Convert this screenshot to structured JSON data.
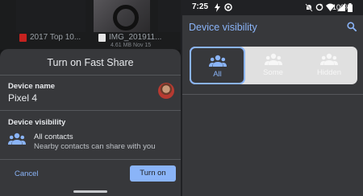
{
  "left": {
    "files": [
      {
        "name": "2017 Top 10...",
        "meta": ""
      },
      {
        "name": "IMG_201911...",
        "meta": "4.61 MB Nov 15"
      }
    ],
    "sheet": {
      "title": "Turn on Fast Share",
      "device_name_label": "Device name",
      "device_name_value": "Pixel 4",
      "visibility_label": "Device visibility",
      "visibility_title": "All contacts",
      "visibility_desc": "Nearby contacts can share with you",
      "cancel_label": "Cancel",
      "turn_on_label": "Turn on"
    }
  },
  "right": {
    "status_bar": {
      "time": "7:25",
      "battery": "100%"
    },
    "title": "Device visibility",
    "options": [
      "All",
      "Some",
      "Hidden"
    ],
    "selected_option": "All"
  },
  "colors": {
    "accent": "#8ab4f8",
    "sheet_bg": "#37383b",
    "segment_bg": "#e0e0e0"
  }
}
